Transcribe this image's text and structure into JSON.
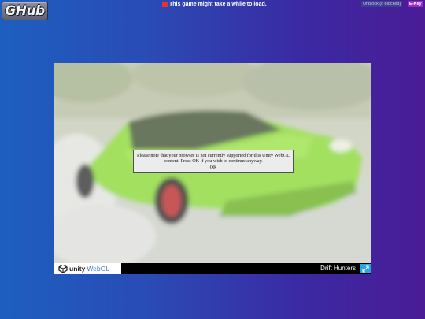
{
  "header": {
    "logo_text": "GHub",
    "notice_text": "This game might take a while to load.",
    "unblock_label": "Unblock (if blocked)",
    "ekey_label": "E-Key"
  },
  "game": {
    "dialog_message": "Please note that your browser is not currently supported for this Unity WebGL content. Press OK if you wish to continue anyway.",
    "ok_label": "OK"
  },
  "footer": {
    "unity_word": "unity",
    "webgl_word": "WebGL",
    "title": "Drift Hunters",
    "fullscreen_icon": "fullscreen-icon"
  },
  "colors": {
    "notice_square": "#e8322f",
    "ekey_bg": "#9b2bc4",
    "unblock_bg": "#3d3f8e",
    "fullscreen_bg": "#29a5e0",
    "car_green": "#8fd93e"
  }
}
